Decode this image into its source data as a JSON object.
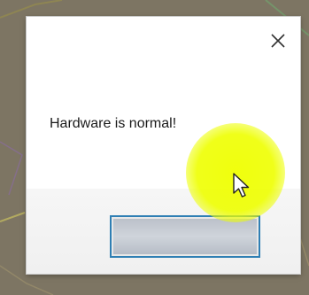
{
  "dialog": {
    "message": "Hardware is normal!",
    "close_icon": "close-icon",
    "ok_button_label": ""
  },
  "colors": {
    "accent": "#2f7fb4",
    "highlight": "#eeff00",
    "background": "#7d7563"
  },
  "pointer": {
    "icon": "cursor-arrow-icon"
  }
}
